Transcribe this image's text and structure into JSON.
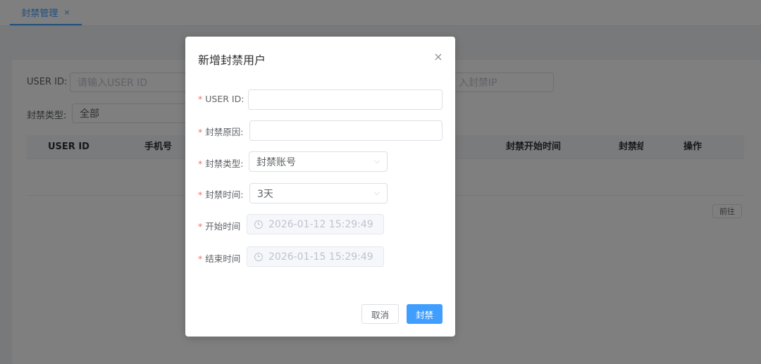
{
  "tab": {
    "label": "封禁管理",
    "close": "×"
  },
  "filters": {
    "user_id_label": "USER ID:",
    "user_id_placeholder": "请输入USER ID",
    "ip_placeholder_partial": "入封禁IP",
    "ban_type_label": "封禁类型:",
    "ban_type_value": "全部"
  },
  "table": {
    "columns": [
      "USER ID",
      "手机号",
      "封禁开始时间",
      "封禁结",
      "操作"
    ]
  },
  "pagination": {
    "goto_label": "前往"
  },
  "dialog": {
    "title": "新增封禁用户",
    "close": "×",
    "fields": {
      "user_id_label": "USER ID:",
      "user_id_value": "",
      "reason_label": "封禁原因:",
      "reason_value": "",
      "type_label": "封禁类型:",
      "type_value": "封禁账号",
      "duration_label": "封禁时间:",
      "duration_value": "3天",
      "start_label": "开始时间",
      "start_value": "2026-01-12 15:29:49",
      "end_label": "结束时间",
      "end_value": "2026-01-15 15:29:49"
    },
    "required_mark": "*",
    "cancel_label": "取消",
    "submit_label": "封禁"
  },
  "colors": {
    "primary": "#409eff",
    "required": "#f56c6c"
  }
}
